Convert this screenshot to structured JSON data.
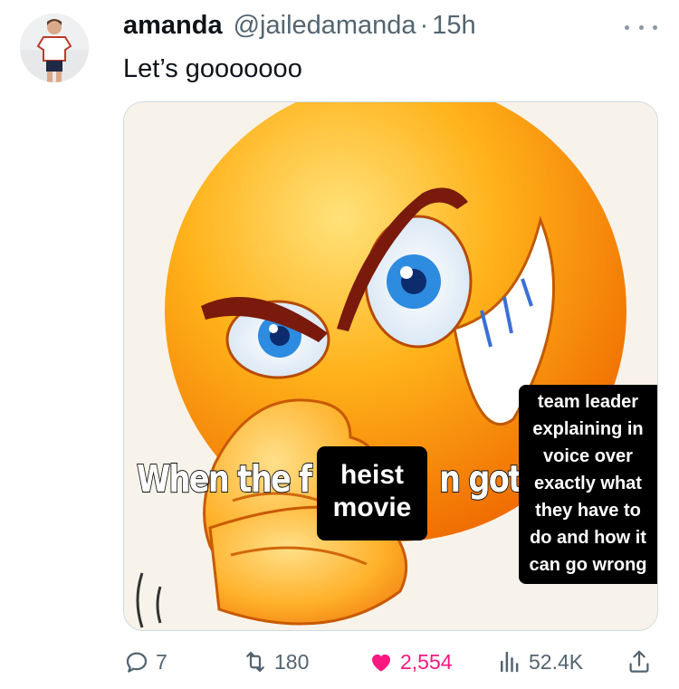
{
  "tweet": {
    "display_name": "amanda",
    "handle": "@jailedamanda",
    "separator": "·",
    "time": "15h",
    "text": "Let’s gooooooo"
  },
  "media": {
    "caption_left": "When the f",
    "caption_right": "n got",
    "label_center": [
      "heist",
      "movie"
    ],
    "label_right": [
      "team leader",
      "explaining in",
      "voice over",
      "exactly what",
      "they have to",
      "do and how it",
      "can go wrong"
    ]
  },
  "actions": {
    "reply_count": "7",
    "retweet_count": "180",
    "like_count": "2,554",
    "views_count": "52.4K"
  },
  "colors": {
    "like_pink": "#f91880",
    "text_primary": "#0f1419",
    "text_secondary": "#536471"
  },
  "icons": [
    "more-icon",
    "reply-icon",
    "retweet-icon",
    "heart-icon",
    "views-icon",
    "share-icon"
  ]
}
